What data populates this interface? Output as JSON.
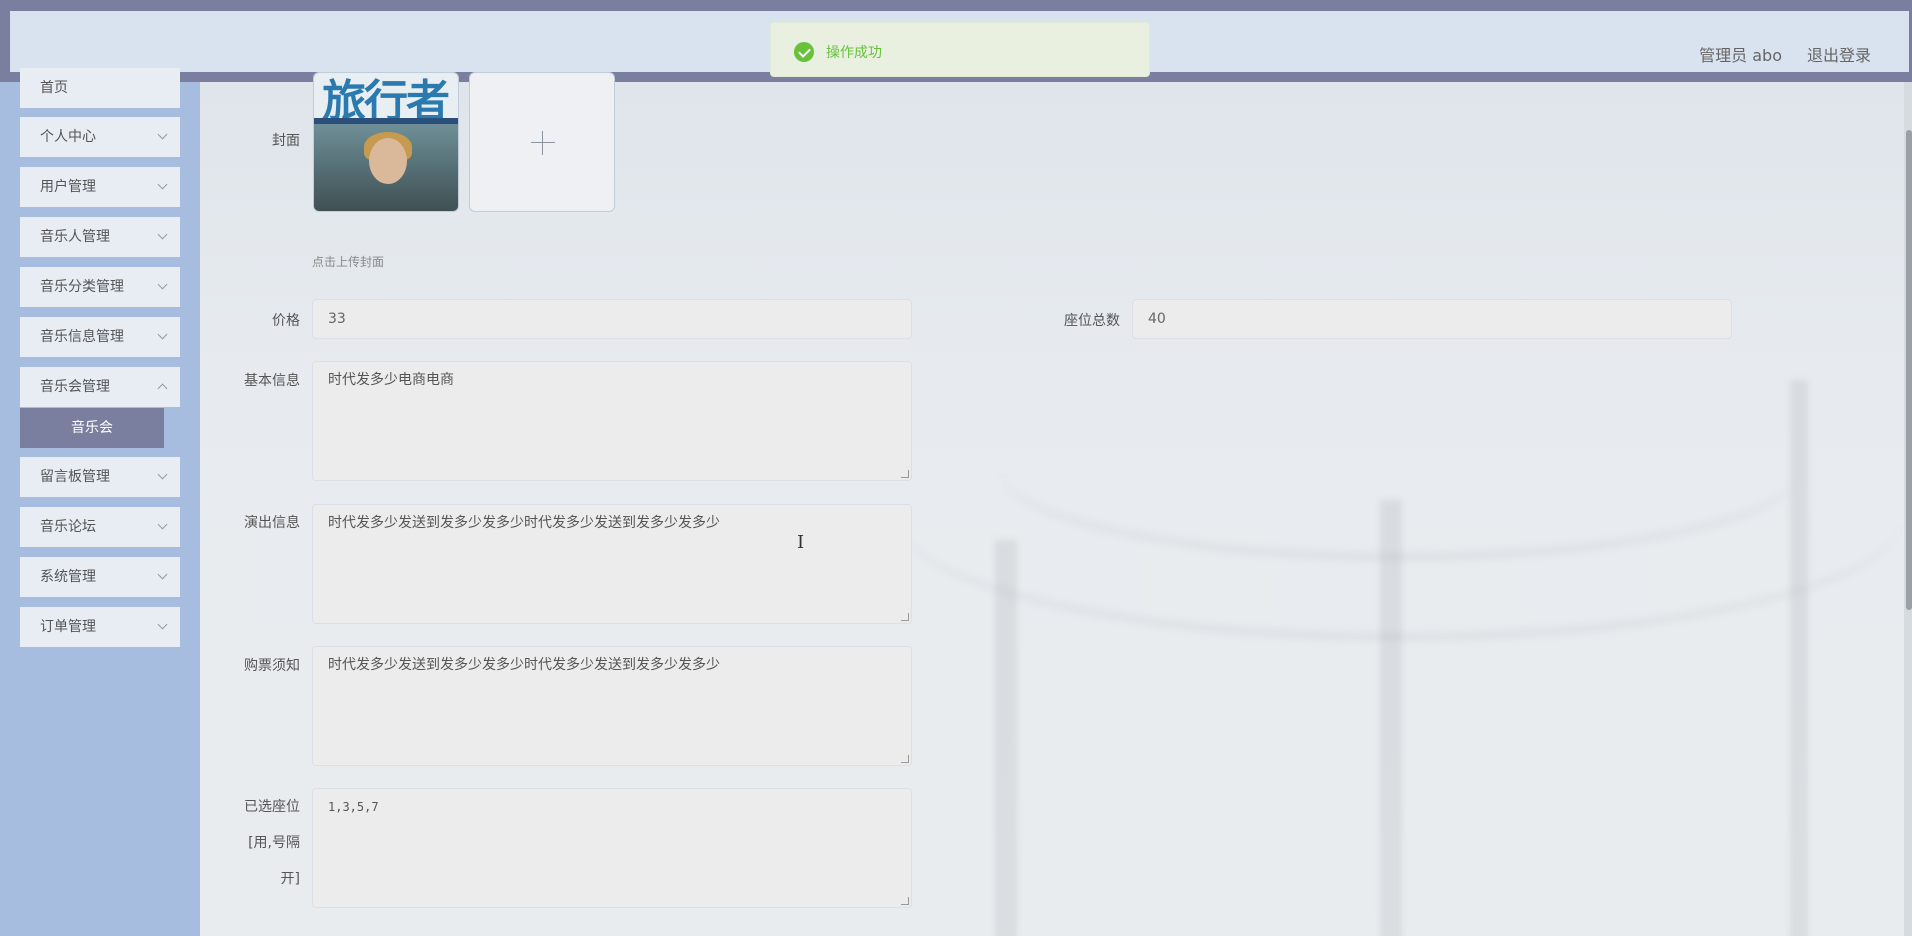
{
  "header": {
    "user_label": "管理员 abo",
    "logout_label": "退出登录"
  },
  "toast": {
    "message": "操作成功"
  },
  "sidebar": {
    "items": [
      {
        "label": "首页"
      },
      {
        "label": "个人中心"
      },
      {
        "label": "用户管理"
      },
      {
        "label": "音乐人管理"
      },
      {
        "label": "音乐分类管理"
      },
      {
        "label": "音乐信息管理"
      },
      {
        "label": "音乐会管理"
      },
      {
        "label": "留言板管理"
      },
      {
        "label": "音乐论坛"
      },
      {
        "label": "系统管理"
      },
      {
        "label": "订单管理"
      }
    ],
    "active_sub": "音乐会"
  },
  "form": {
    "cover_label": "封面",
    "cover_hint": "点击上传封面",
    "cover_magazine_title": "旅行者",
    "price_label": "价格",
    "price_value": "33",
    "seats_label": "座位总数",
    "seats_value": "40",
    "basic_info_label": "基本信息",
    "basic_info_value": "时代发多少电商电商",
    "performance_label": "演出信息",
    "performance_value": "时代发多少发送到发多少发多少时代发多少发送到发多少发多少",
    "notice_label": "购票须知",
    "notice_value": "时代发多少发送到发多少发多少时代发多少发送到发多少发多少",
    "selected_seats_label_line1": "已选座位",
    "selected_seats_label_line2": "[用,号隔",
    "selected_seats_label_line3": "开]",
    "selected_seats_value": "1,3,5,7"
  }
}
